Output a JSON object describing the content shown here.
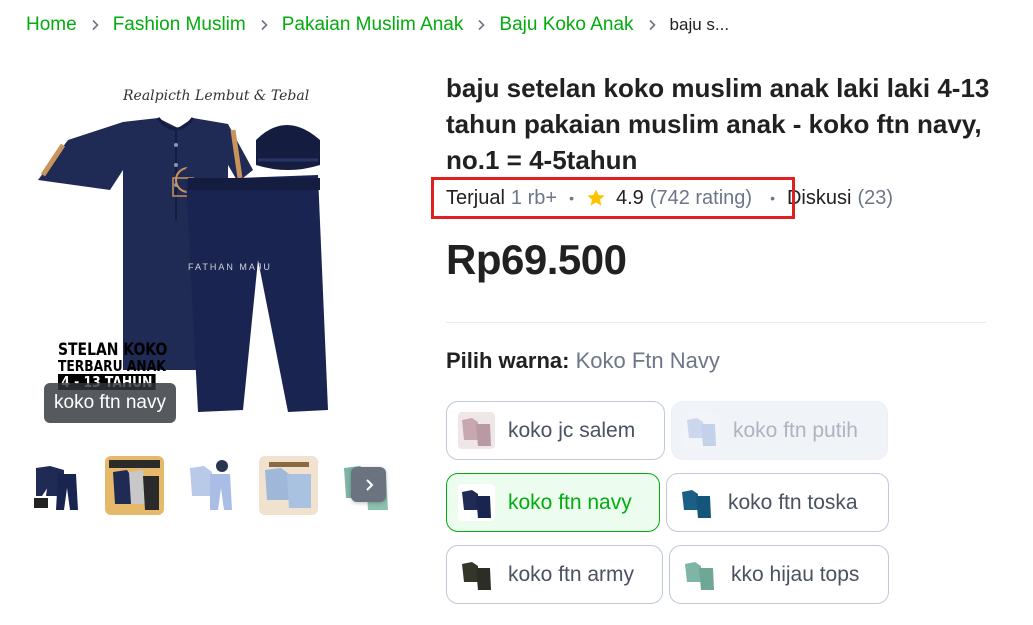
{
  "breadcrumb": {
    "items": [
      "Home",
      "Fashion Muslim",
      "Pakaian Muslim Anak",
      "Baju Koko Anak"
    ],
    "current": "baju s..."
  },
  "gallery": {
    "main_image": {
      "caption": "Realpicth Lembut & Tebal",
      "brand_mark": "FATHAN MAJU",
      "promo_line1": "STELAN KOKO",
      "promo_line2": "TERBARU ANAK",
      "promo_line3": "4 - 13 TAHUN",
      "variant_tag": "koko ftn navy"
    },
    "thumbnails": [
      {
        "icon": "koko-navy-thumbnail"
      },
      {
        "icon": "koko-set-thumbnail"
      },
      {
        "icon": "koko-putih-thumbnail"
      },
      {
        "icon": "koko-salem-thumbnail"
      },
      {
        "icon": "koko-toska-thumbnail"
      }
    ],
    "next_icon": "chevron-right-icon"
  },
  "product": {
    "title": "baju setelan koko muslim anak laki laki 4-13 tahun pakaian muslim anak - koko ftn navy, no.1 = 4-5tahun",
    "sold_label": "Terjual",
    "sold_value": "1 rb+",
    "rating": "4.9",
    "rating_count": "(742 rating)",
    "discussion_label": "Diskusi",
    "discussion_count": "(23)",
    "price": "Rp69.500",
    "accent_color": "#03AC0E",
    "highlight_color": "#E0201E"
  },
  "variant": {
    "label": "Pilih warna:",
    "selected": "Koko Ftn Navy",
    "options": [
      {
        "label": "koko jc salem",
        "state": "normal"
      },
      {
        "label": "koko ftn putih",
        "state": "disabled"
      },
      {
        "label": "koko ftn navy",
        "state": "selected"
      },
      {
        "label": "koko ftn toska",
        "state": "normal"
      },
      {
        "label": "koko ftn army",
        "state": "normal"
      },
      {
        "label": "kko hijau tops",
        "state": "normal"
      }
    ]
  }
}
